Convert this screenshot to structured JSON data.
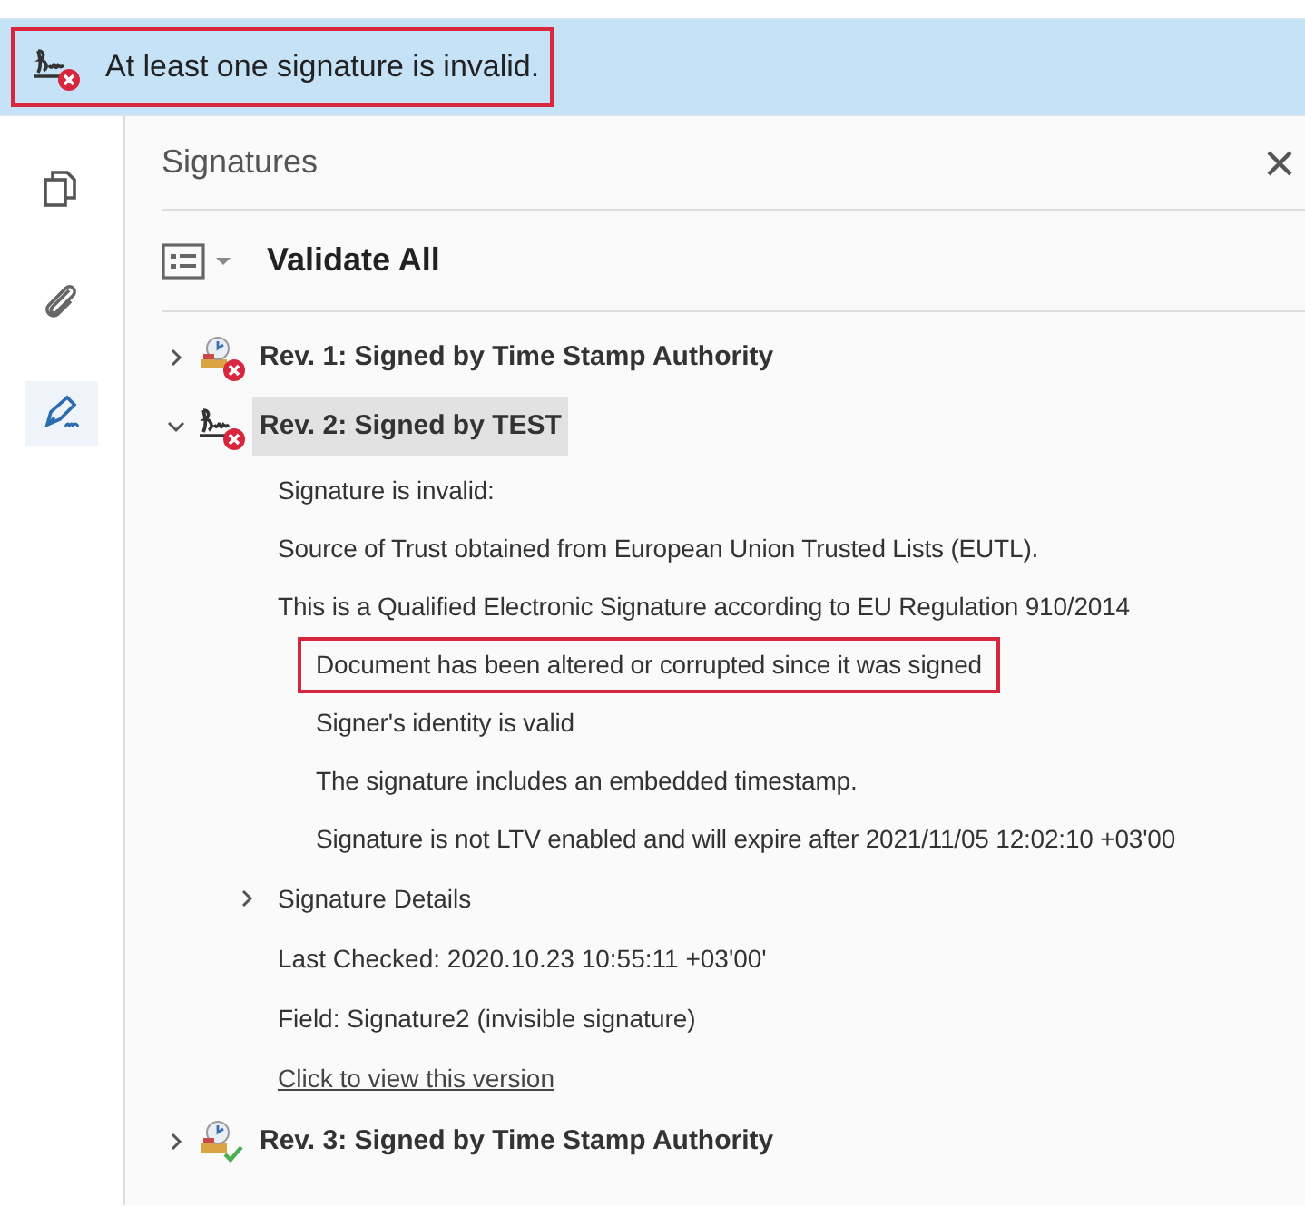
{
  "banner": {
    "text": "At least one signature is invalid.",
    "highlighted": true
  },
  "rail": [
    {
      "kind": "pages",
      "selected": false
    },
    {
      "kind": "attachments",
      "selected": false
    },
    {
      "kind": "signatures",
      "selected": true
    }
  ],
  "panel": {
    "title": "Signatures",
    "validate_label": "Validate All"
  },
  "revisions": [
    {
      "label": "Rev. 1: Signed by Time Stamp Authority",
      "kind": "timestamp",
      "valid": false,
      "expanded": false,
      "selected": false
    },
    {
      "label": "Rev. 2: Signed by TEST",
      "kind": "signature",
      "valid": false,
      "expanded": true,
      "selected": true,
      "details": [
        {
          "text": "Signature is invalid:",
          "highlighted": false
        },
        {
          "text": "Source of Trust obtained from European Union Trusted Lists (EUTL).",
          "highlighted": false
        },
        {
          "text": "This is a Qualified Electronic Signature according to EU Regulation 910/2014",
          "highlighted": false,
          "children": [
            {
              "text": "Document has been altered or corrupted since it was signed",
              "highlighted": true
            },
            {
              "text": "Signer's identity is valid",
              "highlighted": false
            },
            {
              "text": "The signature includes an embedded timestamp.",
              "highlighted": false
            },
            {
              "text": "Signature is not LTV enabled and will expire after 2021/11/05 12:02:10 +03'00",
              "highlighted": false
            }
          ]
        }
      ],
      "signature_details": {
        "label": "Signature Details",
        "expanded": false
      },
      "info": [
        "Last Checked: 2020.10.23 10:55:11 +03'00'",
        "Field: Signature2 (invisible signature)"
      ],
      "link": "Click to view this version"
    },
    {
      "label": "Rev. 3: Signed by Time Stamp Authority",
      "kind": "timestamp",
      "valid": true,
      "expanded": false,
      "selected": false
    }
  ]
}
